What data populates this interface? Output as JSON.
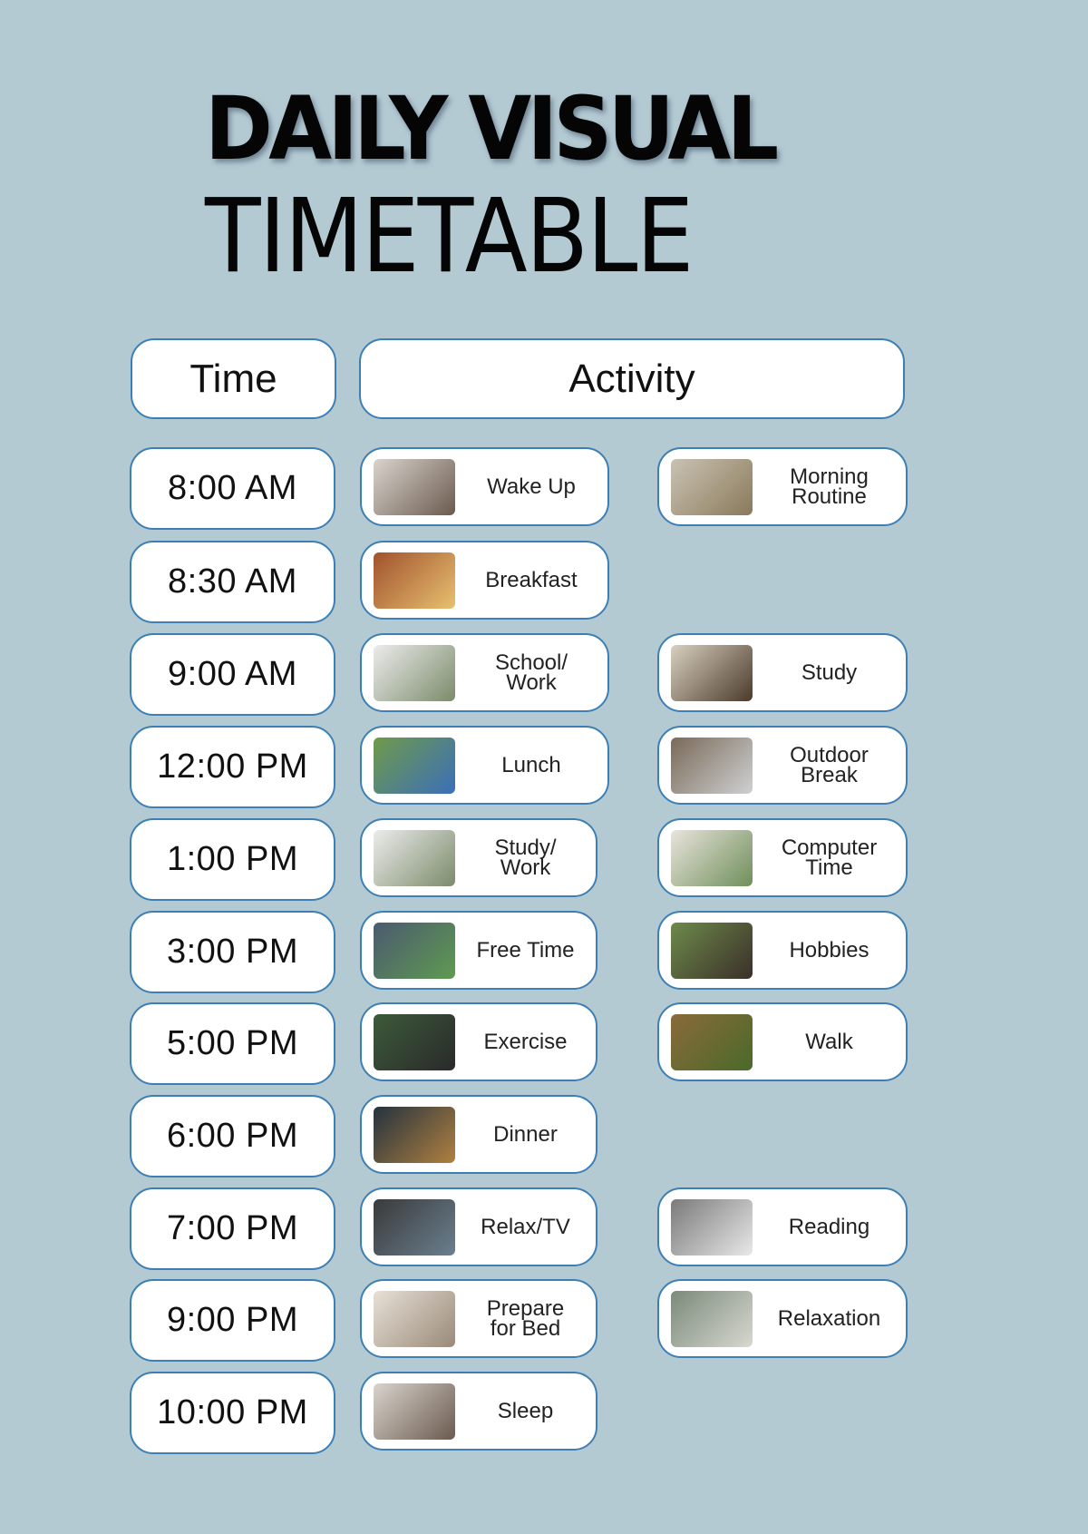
{
  "title": {
    "line1": "DAILY VISUAL",
    "line2": "TIMETABLE"
  },
  "headers": {
    "time": "Time",
    "activity": "Activity"
  },
  "colors": {
    "background": "#b4cad3",
    "border": "#3d7fb4",
    "box": "#ffffff"
  },
  "rows": [
    {
      "time": "8:00 AM",
      "primary": {
        "label": "Wake Up",
        "image": "woman-stretching-photo"
      },
      "secondary": {
        "label": "Morning\nRoutine",
        "image": "alarm-clock-bedside-photo"
      }
    },
    {
      "time": "8:30 AM",
      "primary": {
        "label": "Breakfast",
        "image": "eggs-bacon-coffee-photo"
      },
      "secondary": null
    },
    {
      "time": "9:00 AM",
      "primary": {
        "label": "School/\nWork",
        "image": "laptop-desk-photo"
      },
      "secondary": {
        "label": "Study",
        "image": "books-pencils-desk-photo"
      }
    },
    {
      "time": "12:00 PM",
      "primary": {
        "label": "Lunch",
        "image": "grilled-chicken-bowl-photo"
      },
      "secondary": {
        "label": "Outdoor\nBreak",
        "image": "person-on-grass-photo"
      }
    },
    {
      "time": "1:00 PM",
      "primary": {
        "label": "Study/\nWork",
        "image": "group-meeting-photo"
      },
      "secondary": {
        "label": "Computer\nTime",
        "image": "laptop-desk-photo"
      }
    },
    {
      "time": "3:00 PM",
      "primary": {
        "label": "Free Time",
        "image": "man-relaxing-chair-photo"
      },
      "secondary": {
        "label": "Hobbies",
        "image": "video-game-photo"
      }
    },
    {
      "time": "5:00 PM",
      "primary": {
        "label": "Exercise",
        "image": "man-situps-photo"
      },
      "secondary": {
        "label": "Walk",
        "image": "man-walking-park-photo"
      }
    },
    {
      "time": "6:00 PM",
      "primary": {
        "label": "Dinner",
        "image": "dinner-table-photo"
      },
      "secondary": null
    },
    {
      "time": "7:00 PM",
      "primary": {
        "label": "Relax/TV",
        "image": "family-watching-tv-photo"
      },
      "secondary": {
        "label": "Reading",
        "image": "man-reading-book-photo"
      }
    },
    {
      "time": "9:00 PM",
      "primary": {
        "label": "Prepare\nfor Bed",
        "image": "man-making-bed-photo"
      },
      "secondary": {
        "label": "Relaxation",
        "image": "man-lounging-bed-photo"
      }
    },
    {
      "time": "10:00 PM",
      "primary": {
        "label": "Sleep",
        "image": "man-sleeping-photo"
      },
      "secondary": null
    }
  ]
}
